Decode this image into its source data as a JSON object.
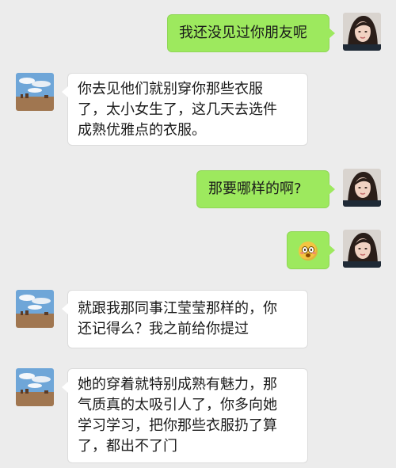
{
  "messages": [
    {
      "side": "right",
      "text": "我还没见过你朋友呢"
    },
    {
      "side": "left",
      "lines": [
        "你去见他们就别穿你那些衣服",
        "了，太小女生了，这几天去选件",
        "成熟优雅点的衣服。"
      ]
    },
    {
      "side": "right",
      "text": "那要哪样的啊?"
    },
    {
      "side": "right",
      "emoji": "flushed-face-emoji"
    },
    {
      "side": "left",
      "lines": [
        "就跟我那同事江莹莹那样的，你",
        "还记得么？我之前给你提过"
      ]
    },
    {
      "side": "left",
      "lines": [
        "她的穿着就特别成熟有魅力，那",
        "气质真的太吸引人了，你多向她",
        "学习学习，把你那些衣服扔了算",
        "了，都出不了门"
      ]
    }
  ],
  "colors": {
    "background": "#ececec",
    "sent_bubble": "#9de95e",
    "received_bubble": "#ffffff"
  }
}
